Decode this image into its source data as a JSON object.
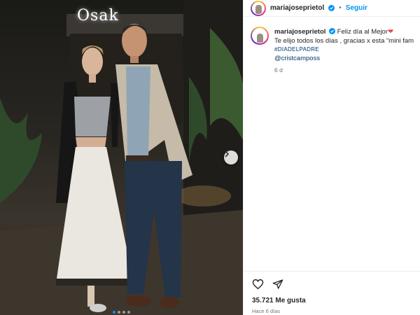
{
  "media": {
    "sign_text": "Osak",
    "carousel": {
      "total": 4,
      "active": 1
    }
  },
  "post": {
    "username": "mariajoseprietol",
    "follow_label": "Seguir",
    "caption": {
      "line1": "Feliz día al Mejor",
      "line2": "Te elijo todos los días , gracias x esta “mini fam",
      "hashtag": "#DIADELPADRE",
      "mention": "@cristcamposs"
    },
    "time_ago": "6 d",
    "likes_label": "35.721 Me gusta",
    "date_label": "Hace 6 días"
  },
  "colors": {
    "accent": "#0095f6",
    "link": "#00376b",
    "heart": "#ed4956"
  }
}
